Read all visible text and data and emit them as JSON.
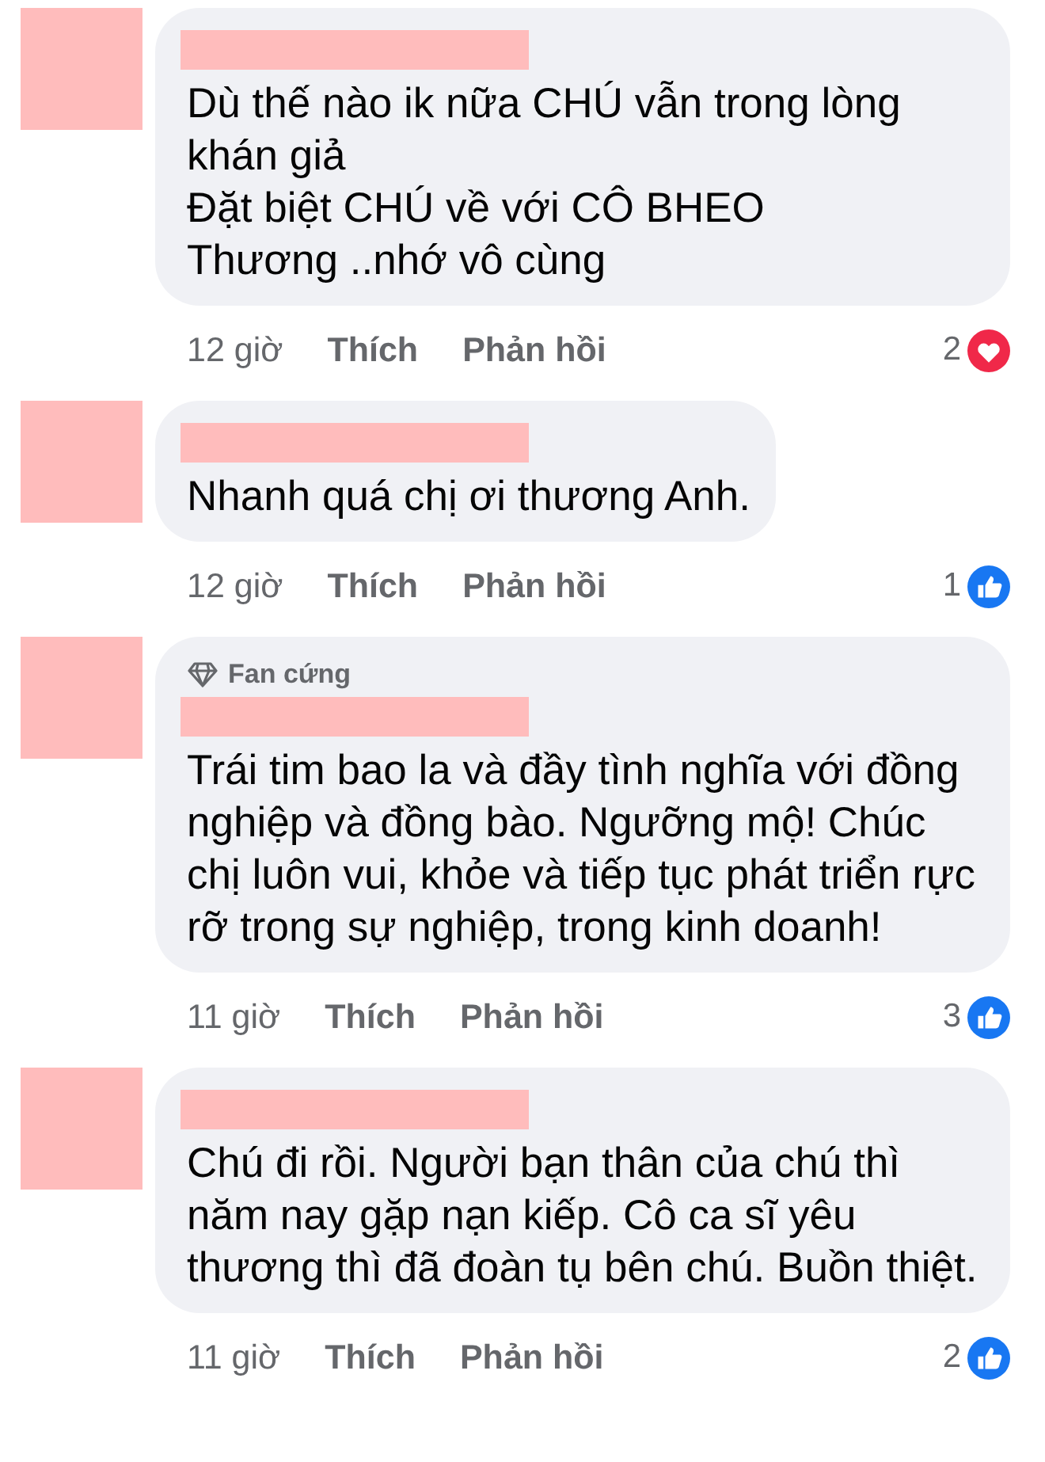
{
  "comments": [
    {
      "text": "Dù thế nào ik nữa CHÚ vẫn trong lòng khán giả\nĐặt biệt CHÚ về với CÔ BHEO\nThương ..nhớ vô cùng",
      "time": "12 giờ",
      "like_label": "Thích",
      "reply_label": "Phản hồi",
      "reaction_count": "2",
      "kind": "love"
    },
    {
      "text": "Nhanh quá chị ơi thương Anh.",
      "time": "12 giờ",
      "like_label": "Thích",
      "reply_label": "Phản hồi",
      "reaction_count": "1",
      "kind": "like"
    },
    {
      "badge": "Fan cứng",
      "text": "Trái tim bao la và đầy tình nghĩa với đồng nghiệp và đồng bào. Ngưỡng mộ!  Chúc chị luôn vui, khỏe và tiếp tục phát triển rực rỡ trong sự nghiệp, trong kinh doanh!",
      "time": "11 giờ",
      "like_label": "Thích",
      "reply_label": "Phản hồi",
      "reaction_count": "3",
      "kind": "like"
    },
    {
      "text": "Chú đi rồi. Người bạn thân của chú thì năm nay gặp nạn kiếp. Cô ca sĩ yêu thương thì đã đoàn tụ bên chú. Buồn thiệt.",
      "time": "11 giờ",
      "like_label": "Thích",
      "reply_label": "Phản hồi",
      "reaction_count": "2",
      "kind": "like"
    }
  ]
}
